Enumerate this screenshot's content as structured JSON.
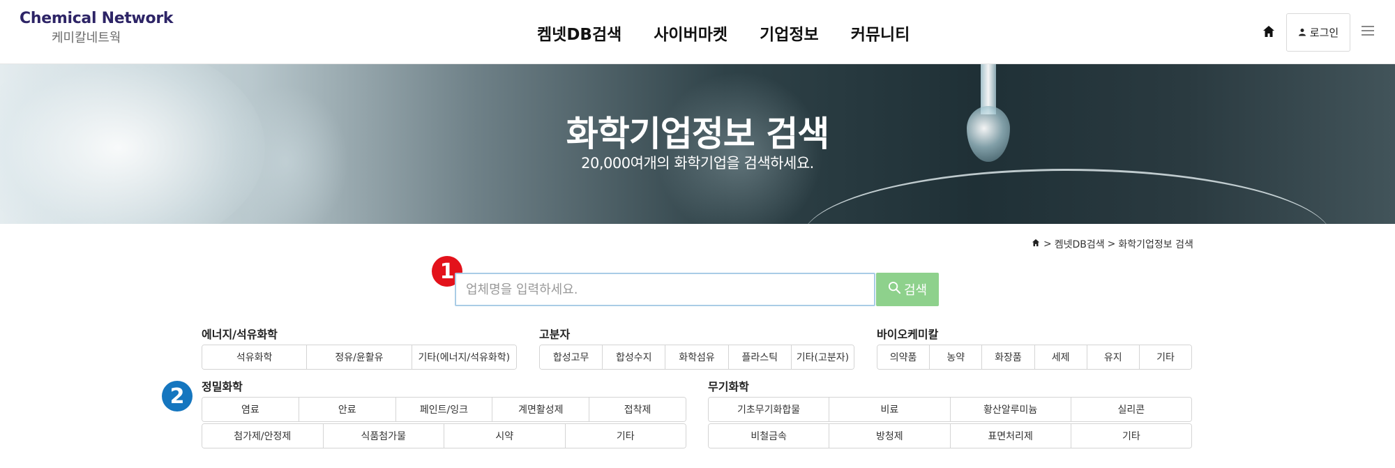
{
  "header": {
    "logo_en": "Chemical Network",
    "logo_ko": "케미칼네트웍",
    "nav": [
      "켐넷DB검색",
      "사이버마켓",
      "기업정보",
      "커뮤니티"
    ],
    "login_label": "로그인",
    "icons": {
      "home": "home-icon",
      "user": "user-icon",
      "menu": "hamburger-menu-icon"
    }
  },
  "hero": {
    "title": "화학기업정보 검색",
    "subtitle": "20,000여개의 화학기업을 검색하세요."
  },
  "breadcrumb": {
    "items": [
      "켐넷DB검색",
      "화학기업정보 검색"
    ],
    "separator": ">"
  },
  "search": {
    "marker": "1",
    "placeholder": "업체명을 입력하세요.",
    "button_label": "검색",
    "button_color": "#8ed18c"
  },
  "categories": {
    "marker": "2",
    "groups": [
      {
        "title": "에너지/석유화학",
        "rows": [
          [
            "석유화학",
            "정유/윤활유",
            "기타(에너지/석유화학)"
          ]
        ]
      },
      {
        "title": "고분자",
        "rows": [
          [
            "합성고무",
            "합성수지",
            "화학섬유",
            "플라스틱",
            "기타(고분자)"
          ]
        ]
      },
      {
        "title": "바이오케미칼",
        "rows": [
          [
            "의약품",
            "농약",
            "화장품",
            "세제",
            "유지",
            "기타"
          ]
        ]
      },
      {
        "title": "정밀화학",
        "rows": [
          [
            "염료",
            "안료",
            "페인트/잉크",
            "계면활성제",
            "접착제"
          ],
          [
            "첨가제/안정제",
            "식품첨가물",
            "시약",
            "기타"
          ]
        ]
      },
      {
        "title": "무기화학",
        "rows": [
          [
            "기초무기화합물",
            "비료",
            "황산알루미늄",
            "실리콘"
          ],
          [
            "비철금속",
            "방청제",
            "표면처리제",
            "기타"
          ]
        ]
      }
    ]
  }
}
